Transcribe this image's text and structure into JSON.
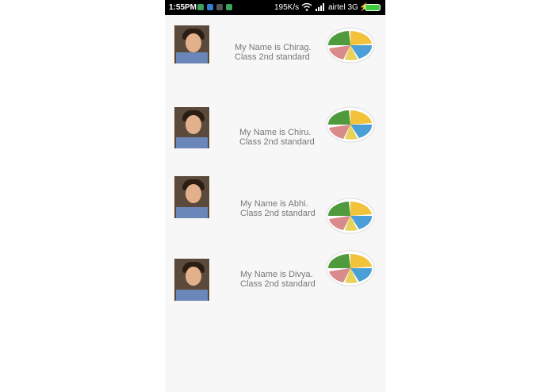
{
  "status_bar": {
    "time": "1:55PM",
    "speed": "195K/s",
    "carrier": "airtel 3G",
    "notification_icons": [
      "app-notification-icon",
      "app-notification-icon",
      "app-notification-icon",
      "app-notification-icon"
    ],
    "battery_color": "#3ecb3e"
  },
  "students": [
    {
      "name_line": "My Name is Chirag.",
      "class_line": "Class 2nd standard",
      "photo_icon": "student-photo",
      "image_icon": "food-plate-icon"
    },
    {
      "name_line": "My Name is Chiru.",
      "class_line": "Class 2nd standard",
      "photo_icon": "student-photo",
      "image_icon": "food-plate-icon"
    },
    {
      "name_line": "My Name is Abhi.",
      "class_line": "Class 2nd standard",
      "photo_icon": "student-photo",
      "image_icon": "food-plate-icon"
    },
    {
      "name_line": "My Name is Divya.",
      "class_line": "Class 2nd standard",
      "photo_icon": "student-photo",
      "image_icon": "food-plate-icon"
    }
  ]
}
